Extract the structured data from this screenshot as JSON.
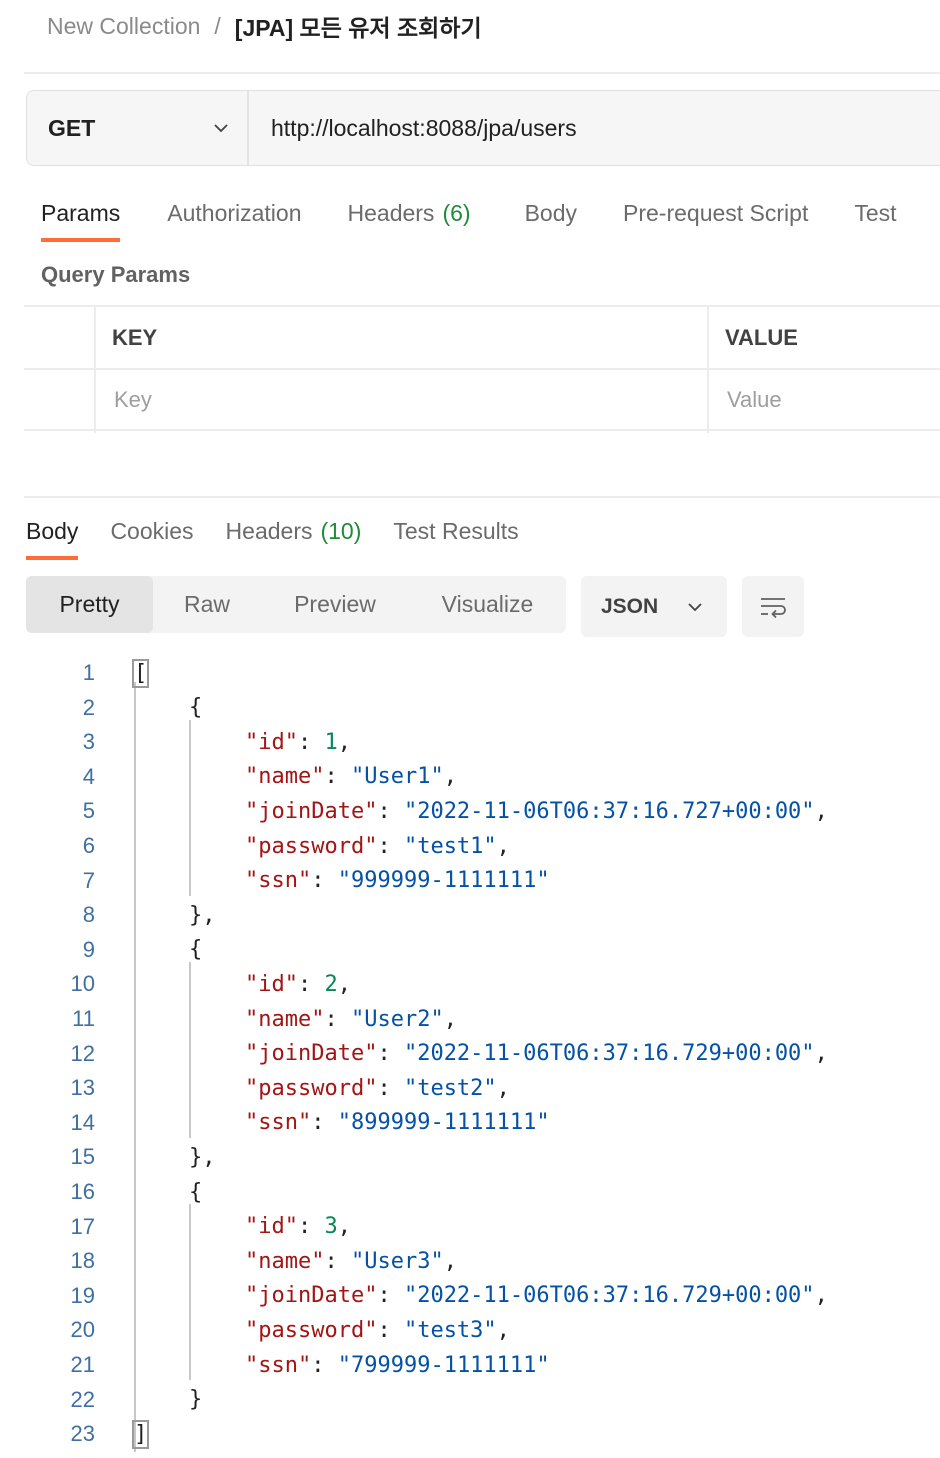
{
  "breadcrumb": {
    "collection": "New Collection",
    "separator": "/",
    "request_name": "[JPA] 모든 유저 조회하기"
  },
  "request": {
    "method": "GET",
    "url": "http://localhost:8088/jpa/users"
  },
  "request_tabs": [
    {
      "label": "Params",
      "active": true
    },
    {
      "label": "Authorization"
    },
    {
      "label": "Headers",
      "count": "(6)"
    },
    {
      "label": "Body"
    },
    {
      "label": "Pre-request Script"
    },
    {
      "label": "Test"
    }
  ],
  "query_params": {
    "title": "Query Params",
    "key_header": "KEY",
    "value_header": "VALUE",
    "key_placeholder": "Key",
    "value_placeholder": "Value"
  },
  "response_tabs": [
    {
      "label": "Body",
      "active": true
    },
    {
      "label": "Cookies"
    },
    {
      "label": "Headers",
      "count": "(10)"
    },
    {
      "label": "Test Results"
    }
  ],
  "format_modes": [
    "Pretty",
    "Raw",
    "Preview",
    "Visualize"
  ],
  "active_format": "Pretty",
  "language": "JSON",
  "colors": {
    "accent": "#ff6c37",
    "count_green": "#1f8b3b",
    "json_key": "#a31515",
    "json_string": "#0451a5",
    "json_number": "#098658",
    "line_number": "#3f6fa3"
  },
  "code_lines": [
    {
      "n": "1",
      "indent": 0,
      "tokens": [
        [
          "p",
          "["
        ]
      ],
      "box": true
    },
    {
      "n": "2",
      "indent": 1,
      "tokens": [
        [
          "p",
          "{"
        ]
      ]
    },
    {
      "n": "3",
      "indent": 2,
      "tokens": [
        [
          "k",
          "\"id\""
        ],
        [
          "p",
          ": "
        ],
        [
          "n",
          "1"
        ],
        [
          "p",
          ","
        ]
      ]
    },
    {
      "n": "4",
      "indent": 2,
      "tokens": [
        [
          "k",
          "\"name\""
        ],
        [
          "p",
          ": "
        ],
        [
          "s",
          "\"User1\""
        ],
        [
          "p",
          ","
        ]
      ]
    },
    {
      "n": "5",
      "indent": 2,
      "tokens": [
        [
          "k",
          "\"joinDate\""
        ],
        [
          "p",
          ": "
        ],
        [
          "s",
          "\"2022-11-06T06:37:16.727+00:00\""
        ],
        [
          "p",
          ","
        ]
      ]
    },
    {
      "n": "6",
      "indent": 2,
      "tokens": [
        [
          "k",
          "\"password\""
        ],
        [
          "p",
          ": "
        ],
        [
          "s",
          "\"test1\""
        ],
        [
          "p",
          ","
        ]
      ]
    },
    {
      "n": "7",
      "indent": 2,
      "tokens": [
        [
          "k",
          "\"ssn\""
        ],
        [
          "p",
          ": "
        ],
        [
          "s",
          "\"999999-1111111\""
        ]
      ]
    },
    {
      "n": "8",
      "indent": 1,
      "tokens": [
        [
          "p",
          "},"
        ]
      ]
    },
    {
      "n": "9",
      "indent": 1,
      "tokens": [
        [
          "p",
          "{"
        ]
      ]
    },
    {
      "n": "10",
      "indent": 2,
      "tokens": [
        [
          "k",
          "\"id\""
        ],
        [
          "p",
          ": "
        ],
        [
          "n",
          "2"
        ],
        [
          "p",
          ","
        ]
      ]
    },
    {
      "n": "11",
      "indent": 2,
      "tokens": [
        [
          "k",
          "\"name\""
        ],
        [
          "p",
          ": "
        ],
        [
          "s",
          "\"User2\""
        ],
        [
          "p",
          ","
        ]
      ]
    },
    {
      "n": "12",
      "indent": 2,
      "tokens": [
        [
          "k",
          "\"joinDate\""
        ],
        [
          "p",
          ": "
        ],
        [
          "s",
          "\"2022-11-06T06:37:16.729+00:00\""
        ],
        [
          "p",
          ","
        ]
      ]
    },
    {
      "n": "13",
      "indent": 2,
      "tokens": [
        [
          "k",
          "\"password\""
        ],
        [
          "p",
          ": "
        ],
        [
          "s",
          "\"test2\""
        ],
        [
          "p",
          ","
        ]
      ]
    },
    {
      "n": "14",
      "indent": 2,
      "tokens": [
        [
          "k",
          "\"ssn\""
        ],
        [
          "p",
          ": "
        ],
        [
          "s",
          "\"899999-1111111\""
        ]
      ]
    },
    {
      "n": "15",
      "indent": 1,
      "tokens": [
        [
          "p",
          "},"
        ]
      ]
    },
    {
      "n": "16",
      "indent": 1,
      "tokens": [
        [
          "p",
          "{"
        ]
      ]
    },
    {
      "n": "17",
      "indent": 2,
      "tokens": [
        [
          "k",
          "\"id\""
        ],
        [
          "p",
          ": "
        ],
        [
          "n",
          "3"
        ],
        [
          "p",
          ","
        ]
      ]
    },
    {
      "n": "18",
      "indent": 2,
      "tokens": [
        [
          "k",
          "\"name\""
        ],
        [
          "p",
          ": "
        ],
        [
          "s",
          "\"User3\""
        ],
        [
          "p",
          ","
        ]
      ]
    },
    {
      "n": "19",
      "indent": 2,
      "tokens": [
        [
          "k",
          "\"joinDate\""
        ],
        [
          "p",
          ": "
        ],
        [
          "s",
          "\"2022-11-06T06:37:16.729+00:00\""
        ],
        [
          "p",
          ","
        ]
      ]
    },
    {
      "n": "20",
      "indent": 2,
      "tokens": [
        [
          "k",
          "\"password\""
        ],
        [
          "p",
          ": "
        ],
        [
          "s",
          "\"test3\""
        ],
        [
          "p",
          ","
        ]
      ]
    },
    {
      "n": "21",
      "indent": 2,
      "tokens": [
        [
          "k",
          "\"ssn\""
        ],
        [
          "p",
          ": "
        ],
        [
          "s",
          "\"799999-1111111\""
        ]
      ]
    },
    {
      "n": "22",
      "indent": 1,
      "tokens": [
        [
          "p",
          "}"
        ]
      ]
    },
    {
      "n": "23",
      "indent": 0,
      "tokens": [
        [
          "p",
          "]"
        ]
      ],
      "box": true
    }
  ]
}
